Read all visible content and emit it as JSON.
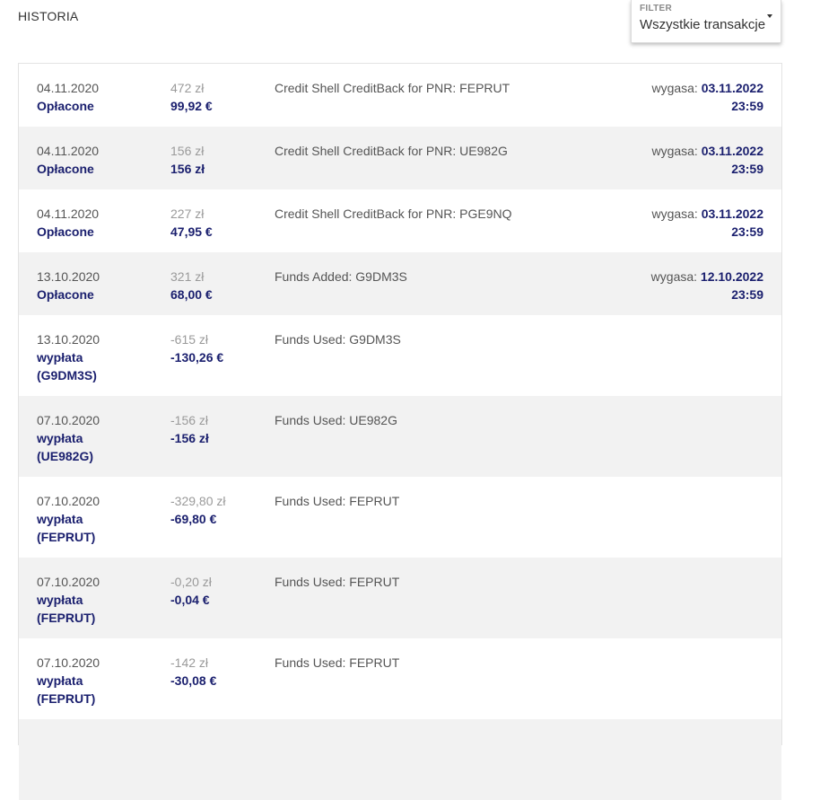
{
  "title": "HISTORIA",
  "filter": {
    "label": "FILTER",
    "value": "Wszystkie transakcje"
  },
  "rows": [
    {
      "date": "04.11.2020",
      "status": "Opłacone",
      "pln": "472 zł",
      "eur": "99,92 €",
      "desc": "Credit Shell CreditBack for PNR: FEPRUT",
      "exp_label": "wygasa:",
      "exp_date": "03.11.2022",
      "exp_time": "23:59"
    },
    {
      "date": "04.11.2020",
      "status": "Opłacone",
      "pln": "156 zł",
      "eur": "156 zł",
      "desc": "Credit Shell CreditBack for PNR: UE982G",
      "exp_label": "wygasa:",
      "exp_date": "03.11.2022",
      "exp_time": "23:59"
    },
    {
      "date": "04.11.2020",
      "status": "Opłacone",
      "pln": "227 zł",
      "eur": "47,95 €",
      "desc": "Credit Shell CreditBack for PNR: PGE9NQ",
      "exp_label": "wygasa:",
      "exp_date": "03.11.2022",
      "exp_time": "23:59"
    },
    {
      "date": "13.10.2020",
      "status": "Opłacone",
      "pln": "321 zł",
      "eur": "68,00 €",
      "desc": "Funds Added: G9DM3S",
      "exp_label": "wygasa:",
      "exp_date": "12.10.2022",
      "exp_time": "23:59"
    },
    {
      "date": "13.10.2020",
      "status": "wypłata",
      "status2": "(G9DM3S)",
      "pln": "-615 zł",
      "eur": "-130,26 €",
      "desc": "Funds Used: G9DM3S"
    },
    {
      "date": "07.10.2020",
      "status": "wypłata",
      "status2": "(UE982G)",
      "pln": "-156 zł",
      "eur": "-156 zł",
      "desc": "Funds Used: UE982G"
    },
    {
      "date": "07.10.2020",
      "status": "wypłata",
      "status2": "(FEPRUT)",
      "pln": "-329,80 zł",
      "eur": "-69,80 €",
      "desc": "Funds Used: FEPRUT"
    },
    {
      "date": "07.10.2020",
      "status": "wypłata",
      "status2": "(FEPRUT)",
      "pln": "-0,20 zł",
      "eur": "-0,04 €",
      "desc": "Funds Used: FEPRUT"
    },
    {
      "date": "07.10.2020",
      "status": "wypłata",
      "status2": "(FEPRUT)",
      "pln": "-142 zł",
      "eur": "-30,08 €",
      "desc": "Funds Used: FEPRUT"
    }
  ]
}
